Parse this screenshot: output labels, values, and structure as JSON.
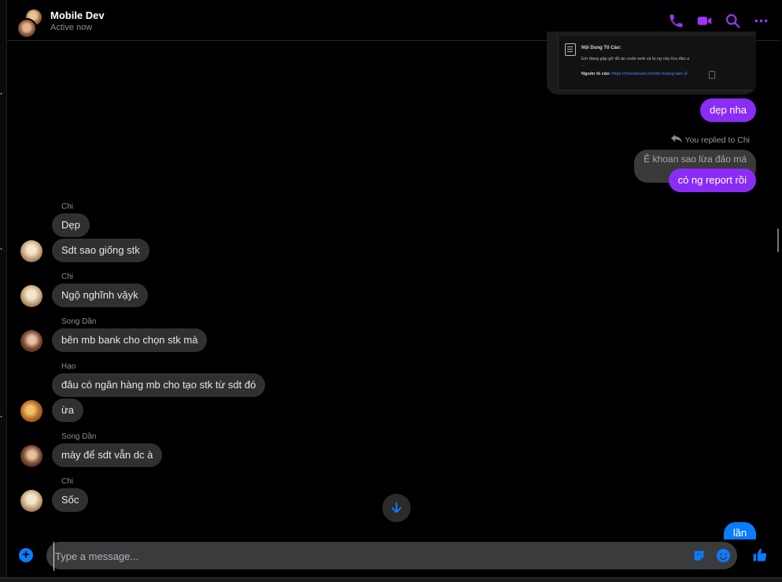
{
  "header": {
    "title": "Mobile Dev",
    "subtitle": "Active now",
    "icons": [
      "phone-icon",
      "video-icon",
      "search-icon",
      "more-icon"
    ],
    "accent_color": "#a033ff"
  },
  "attachment": {
    "title": "Nội Dung Tố Cáo:",
    "body": "Em đang gặp gỡ đồ án code web và bị ng này lừa đảo a",
    "ellipsis": "..",
    "source_label": "Nguồn tố cáo:",
    "source_link": "https://checkscam.info/do-hoang-lam-2/"
  },
  "messages": {
    "out_1": "dẹp nha",
    "reply_label": "You replied to Chi",
    "quoted": "Ê khoan sao lừa đảo má",
    "out_2": "có ng report rồi",
    "sender_chi_1": "Chi",
    "in_1": "Dẹp",
    "in_2": "Sdt sao giống stk",
    "sender_chi_2": "Chi",
    "in_3": "Ngộ nghĩnh vậyk",
    "sender_songdan_1": "Song Dần",
    "in_4": "bên mb bank cho chọn stk mà",
    "sender_hao": "Hạo",
    "in_5": "đâu có ngân hàng mb cho tạo stk từ sdt đó",
    "in_6": "ừa",
    "sender_songdan_2": "Song Dần",
    "in_7": "mày để sdt vẫn dc à",
    "sender_chi_3": "Chi",
    "in_8": "Sốc",
    "partial_out": "lần"
  },
  "composer": {
    "placeholder": "Type a message...",
    "value": ""
  },
  "colors": {
    "outgoing_bubble": "#8b2cf5",
    "incoming_bubble": "#303030",
    "link_blue": "#0a7cff"
  }
}
